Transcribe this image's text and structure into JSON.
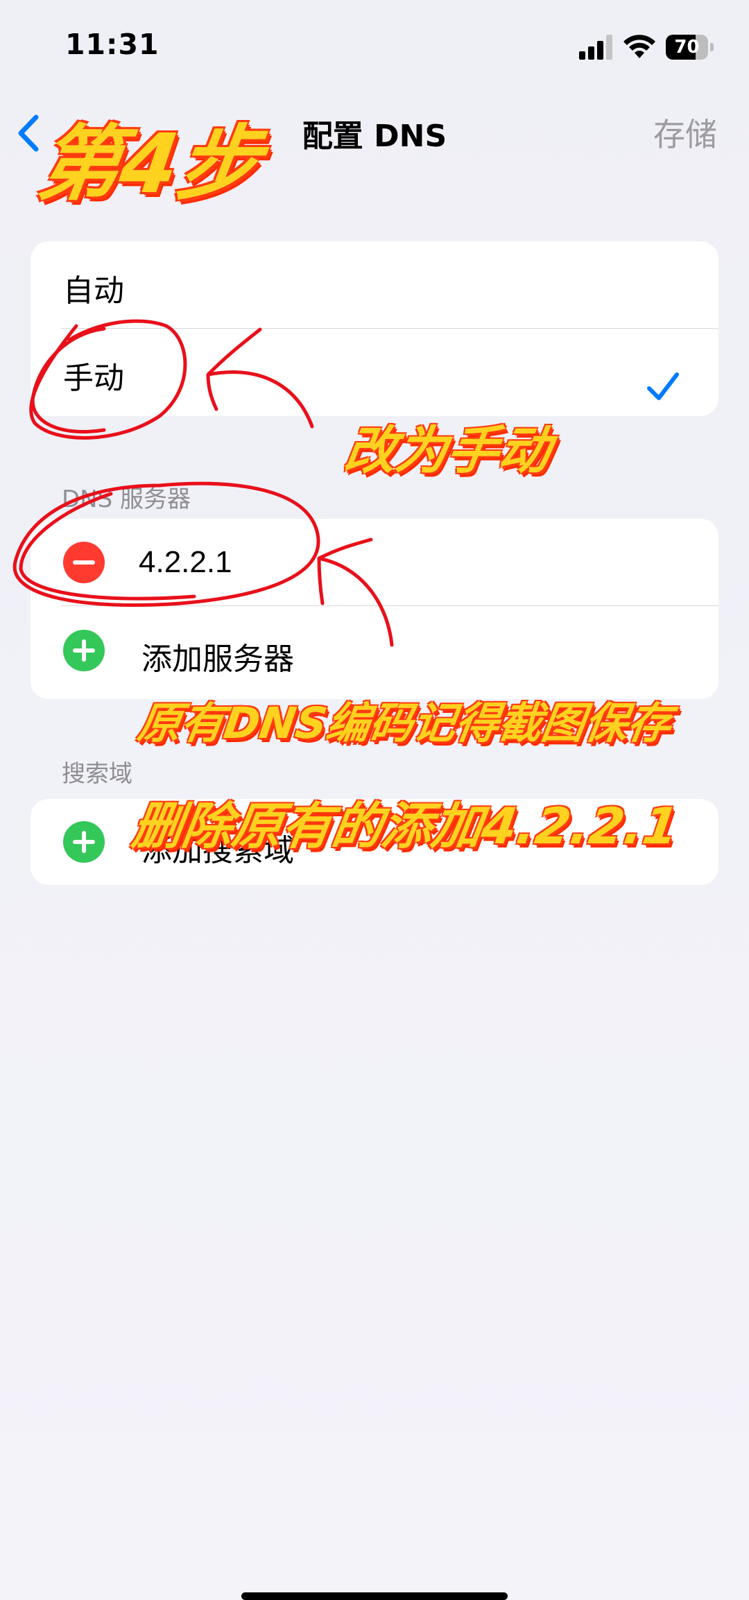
{
  "status_bar": {
    "time": "11:31",
    "battery_level": 70,
    "battery_text": "70"
  },
  "nav": {
    "title": "配置 DNS",
    "save_label": "存储"
  },
  "mode_section": {
    "options": [
      {
        "label": "自动",
        "selected": false
      },
      {
        "label": "手动",
        "selected": true
      }
    ]
  },
  "dns_section": {
    "header": "DNS 服务器",
    "servers": [
      "4.2.2.1"
    ],
    "add_label": "添加服务器"
  },
  "search_section": {
    "header": "搜索域",
    "add_label": "添加搜索域"
  },
  "annotations": {
    "step": "第4步",
    "note_manual": "改为手动",
    "note_save": "原有DNS编码记得截图保存",
    "note_replace": "删除原有的添加4.2.2.1"
  },
  "colors": {
    "accent": "#007aff",
    "delete": "#ff3b30",
    "add": "#34c759",
    "annotation_fill": "#ffd21f",
    "annotation_stroke": "#ff3b10",
    "circle_ink": "#e8101a"
  }
}
